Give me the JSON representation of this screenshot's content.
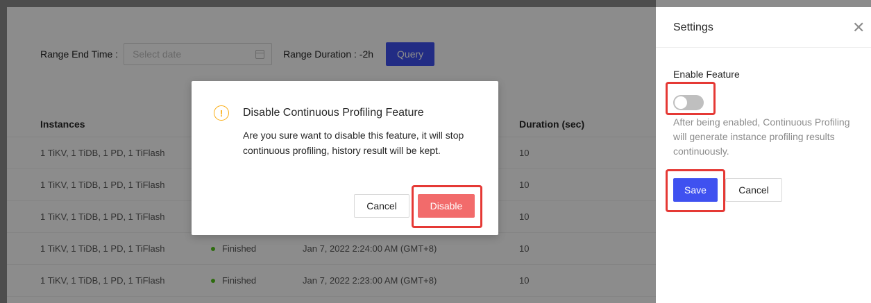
{
  "filters": {
    "range_end_label": "Range End Time :",
    "date_placeholder": "Select date",
    "range_duration_label": "Range Duration : -2h",
    "query_button": "Query"
  },
  "table": {
    "headers": {
      "instances": "Instances",
      "duration": "Duration (sec)"
    },
    "rows": [
      {
        "instances": "1 TiKV, 1 TiDB, 1 PD, 1 TiFlash",
        "status": "",
        "time": "",
        "duration": "10"
      },
      {
        "instances": "1 TiKV, 1 TiDB, 1 PD, 1 TiFlash",
        "status": "",
        "time": "",
        "duration": "10"
      },
      {
        "instances": "1 TiKV, 1 TiDB, 1 PD, 1 TiFlash",
        "status": "",
        "time": "",
        "duration": "10"
      },
      {
        "instances": "1 TiKV, 1 TiDB, 1 PD, 1 TiFlash",
        "status": "Finished",
        "time": "Jan 7, 2022 2:24:00 AM (GMT+8)",
        "duration": "10"
      },
      {
        "instances": "1 TiKV, 1 TiDB, 1 PD, 1 TiFlash",
        "status": "Finished",
        "time": "Jan 7, 2022 2:23:00 AM (GMT+8)",
        "duration": "10"
      }
    ]
  },
  "modal": {
    "icon": "exclamation-circle-icon",
    "title": "Disable Continuous Profiling Feature",
    "content": "Are you sure want to disable this feature, it will stop continuous profiling, history result will be kept.",
    "cancel_label": "Cancel",
    "disable_label": "Disable"
  },
  "drawer": {
    "title": "Settings",
    "close_icon": "close-icon",
    "enable_label": "Enable Feature",
    "switch_on": false,
    "help_text": "After being enabled, Continuous Profiling will generate instance profiling results continuously.",
    "save_label": "Save",
    "cancel_label": "Cancel"
  },
  "colors": {
    "primary": "#3f51f0",
    "danger": "#f26b6b",
    "warning": "#faad14",
    "highlight": "#e53935",
    "success": "#52c41a"
  }
}
